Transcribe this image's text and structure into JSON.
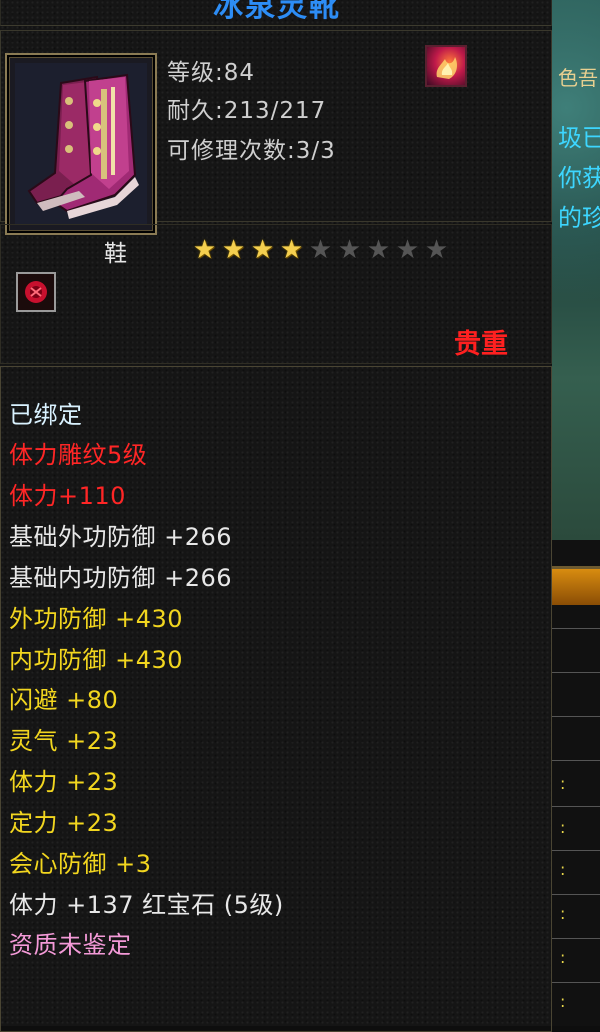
{
  "item": {
    "title": "冰泉灵靴",
    "level": "等级:84",
    "durability": "耐久:213/217",
    "repair_count": "可修理次数:3/3",
    "slot": "鞋",
    "stars_total": 9,
    "stars_filled": 4,
    "rarity": "贵重"
  },
  "properties": [
    {
      "text": "已绑定",
      "color": "cyan"
    },
    {
      "text": "体力雕纹5级",
      "color": "red"
    },
    {
      "text": "体力+110",
      "color": "red"
    },
    {
      "text": "基础外功防御 +266",
      "color": "white"
    },
    {
      "text": "基础内功防御 +266",
      "color": "white"
    },
    {
      "text": "外功防御 +430",
      "color": "yellow"
    },
    {
      "text": "内功防御 +430",
      "color": "yellow"
    },
    {
      "text": "闪避 +80",
      "color": "yellow"
    },
    {
      "text": "灵气 +23",
      "color": "yellow"
    },
    {
      "text": "体力 +23",
      "color": "yellow"
    },
    {
      "text": "定力 +23",
      "color": "yellow"
    },
    {
      "text": "会心防御 +3",
      "color": "yellow"
    },
    {
      "text": "体力 +137 红宝石 (5级)",
      "color": "white"
    },
    {
      "text": "资质未鉴定",
      "color": "pink"
    }
  ],
  "background_game": {
    "text_1": "色吾",
    "text_2": "圾已",
    "text_3": "你获",
    "text_4": "的珍"
  },
  "icons": {
    "item_icon": "boots-icon",
    "bound_icon": "flame-badge-icon",
    "gem_icon": "red-gem-icon",
    "star_icon": "star-icon"
  }
}
